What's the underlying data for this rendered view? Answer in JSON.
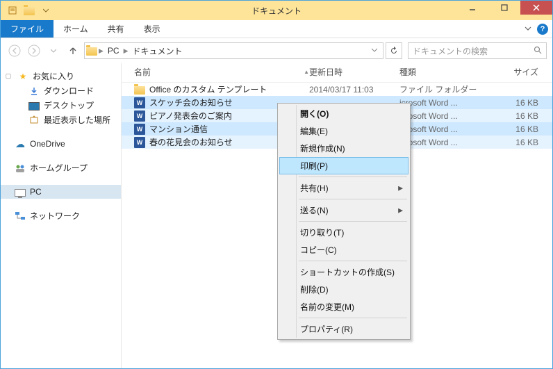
{
  "window": {
    "title": "ドキュメント"
  },
  "ribbon": {
    "file": "ファイル",
    "home": "ホーム",
    "share": "共有",
    "view": "表示"
  },
  "address": {
    "pc": "PC",
    "loc": "ドキュメント"
  },
  "search": {
    "placeholder": "ドキュメントの検索"
  },
  "sidebar": {
    "fav": "お気に入り",
    "downloads": "ダウンロード",
    "desktop": "デスクトップ",
    "recent": "最近表示した場所",
    "onedrive": "OneDrive",
    "homegroup": "ホームグループ",
    "pc": "PC",
    "network": "ネットワーク"
  },
  "columns": {
    "name": "名前",
    "date": "更新日時",
    "type": "種類",
    "size": "サイズ"
  },
  "rows": [
    {
      "name": "Office のカスタム テンプレート",
      "date": "2014/03/17 11:03",
      "type": "ファイル フォルダー",
      "size": "",
      "icon": "folder",
      "sel": ""
    },
    {
      "name": "スケッチ会のお知らせ",
      "date": "",
      "type": "icrosoft Word ...",
      "size": "16 KB",
      "icon": "word",
      "sel": "sel"
    },
    {
      "name": "ピアノ発表会のご案内",
      "date": "",
      "type": "icrosoft Word ...",
      "size": "16 KB",
      "icon": "word",
      "sel": "sel alt"
    },
    {
      "name": "マンション通信",
      "date": "",
      "type": "icrosoft Word ...",
      "size": "16 KB",
      "icon": "word",
      "sel": "sel"
    },
    {
      "name": "春の花見会のお知らせ",
      "date": "",
      "type": "icrosoft Word ...",
      "size": "16 KB",
      "icon": "word",
      "sel": "sel alt"
    }
  ],
  "contextMenu": {
    "open": "開く(O)",
    "edit": "編集(E)",
    "new": "新規作成(N)",
    "print": "印刷(P)",
    "share": "共有(H)",
    "sendto": "送る(N)",
    "cut": "切り取り(T)",
    "copy": "コピー(C)",
    "shortcut": "ショートカットの作成(S)",
    "delete": "削除(D)",
    "rename": "名前の変更(M)",
    "properties": "プロパティ(R)"
  }
}
